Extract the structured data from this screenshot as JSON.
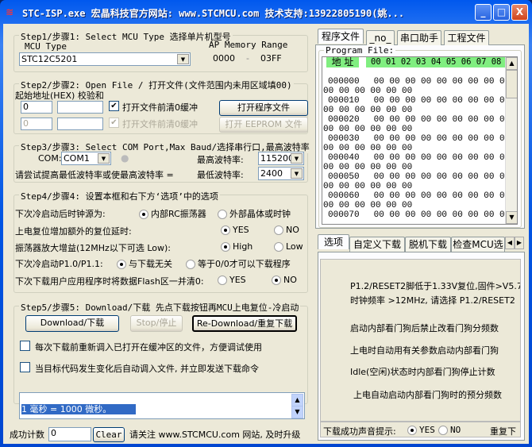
{
  "window": {
    "title": "STC-ISP.exe    宏晶科技官方网站: www.STCMCU.com  技术支持:13922805190(姚...",
    "controls": {
      "minimize": "_",
      "maximize": "□",
      "close": "X"
    }
  },
  "step1": {
    "legend": "Step1/步骤1: Select MCU Type  选择单片机型号",
    "mcu_type_label": "MCU Type",
    "mcu_type_value": "STC12C5201",
    "ap_memory_label": "AP Memory Range",
    "ap_start": "0000",
    "ap_dash": "-",
    "ap_end": "03FF"
  },
  "step2": {
    "legend": "Step2/步骤2: Open File / 打开文件(文件范围内未用区域填00)",
    "start_addr_label": "起始地址(HEX) 校验和",
    "addr1": "0",
    "checksum1": "",
    "clear_cb1_label": "打开文件前清0缓冲",
    "clear_cb1_checked": true,
    "open_program_btn": "打开程序文件",
    "addr2": "0",
    "checksum2": "",
    "clear_cb2_label": "打开文件前清0缓冲",
    "clear_cb2_checked": true,
    "open_eeprom_btn": "打开 EEPROM 文件"
  },
  "step3": {
    "legend": "Step3/步骤3: Select COM Port,Max Baud/选择串行口,最高波特率",
    "com_label": "COM:",
    "com_value": "COM1",
    "max_baud_label": "最高波特率:",
    "max_baud_value": "115200",
    "hint": "请尝试提高最低波特率或使最高波特率 =",
    "min_baud_label": "最低波特率:",
    "min_baud_value": "2400"
  },
  "step4": {
    "legend": "Step4/步骤4: 设置本框和右下方‘选项’中的选项",
    "rows": [
      {
        "label": "下次冷启动后时钟源为:",
        "opt1": "内部RC振荡器",
        "opt2": "外部晶体或时钟",
        "selected": 1
      },
      {
        "label": "上电复位增加额外的复位延时:",
        "opt1": "YES",
        "opt2": "NO",
        "selected": 1
      },
      {
        "label": "振荡器放大增益(12MHz以下可选 Low):",
        "opt1": "High",
        "opt2": "Low",
        "selected": 1
      },
      {
        "label": "下次冷启动P1.0/P1.1:",
        "opt1": "与下载无关",
        "opt2": "等于0/0才可以下载程序",
        "selected": 1
      },
      {
        "label": "下次下载用户应用程序时将数据Flash区一并清0:",
        "opt1": "YES",
        "opt2": "NO",
        "selected": 2
      }
    ]
  },
  "step5": {
    "legend": "Step5/步骤5: Download/下载  先点下载按钮再MCU上电复位-冷启动",
    "download_btn": "Download/下载",
    "stop_btn": "Stop/停止",
    "redownload_btn": "Re-Download/重复下载",
    "reload_cb_label": "每次下载前重新调入已打开在缓冲区的文件，方便调试使用",
    "reload_cb_checked": false,
    "auto_cb_label": "当目标代码发生变化后自动调入文件, 并立即发送下载命令",
    "auto_cb_checked": false,
    "log_text": "  1 毫秒 = 1000 微秒。"
  },
  "footer": {
    "success_count_label": "成功计数",
    "success_count": "0",
    "clear_btn": "Clear",
    "notice": "请关注 www.STCMCU.com 网站, 及时升级"
  },
  "right_tabs": [
    "程序文件",
    "_no_",
    "串口助手",
    "工程文件"
  ],
  "program_file": {
    "legend": "Program File:",
    "addr_header": "地 址",
    "col_header": "00 01 02 03 04 05 06 07 08 0",
    "rows": [
      {
        "addr": "000000",
        "bytes": "00 00 00 00 00 00 00 00 0",
        "cont": "00 00 00 00 00 00"
      },
      {
        "addr": "000010",
        "bytes": "00 00 00 00 00 00 00 00 0",
        "cont": "00 00 00 00 00 00"
      },
      {
        "addr": "000020",
        "bytes": "00 00 00 00 00 00 00 00 0",
        "cont": "00 00 00 00 00 00"
      },
      {
        "addr": "000030",
        "bytes": "00 00 00 00 00 00 00 00 0",
        "cont": "00 00 00 00 00 00"
      },
      {
        "addr": "000040",
        "bytes": "00 00 00 00 00 00 00 00 0",
        "cont": "00 00 00 00 00 00"
      },
      {
        "addr": "000050",
        "bytes": "00 00 00 00 00 00 00 00 0",
        "cont": "00 00 00 00 00 00"
      },
      {
        "addr": "000060",
        "bytes": "00 00 00 00 00 00 00 00 0",
        "cont": "00 00 00 00 00 00"
      },
      {
        "addr": "000070",
        "bytes": "00 00 00 00 00 00 00 00 0",
        "cont": ""
      }
    ]
  },
  "option_tabs": [
    "选项",
    "自定义下载",
    "脱机下载",
    "检查MCU选"
  ],
  "options": {
    "lines": [
      "P1.2/RESET2脚低于1.33V复位,固件>V5.7",
      "时钟频率 >12MHz, 请选择 P1.2/RESET2",
      "启动内部看门狗后禁止改看门狗分频数",
      "上电时自动用有关参数启动内部看门狗",
      "Idle(空闲)状态时内部看门狗停止计数",
      "上电自动启动内部看门狗时的预分频数"
    ],
    "sound_label": "下载成功声音提示:",
    "sound_yes": "YES",
    "sound_no": "NO",
    "sound_selected": "YES",
    "repeat_label": "重复下"
  },
  "colors": {
    "title_bar": "#0054e3",
    "hex_header": "#80ee80",
    "selection": "#316ac5",
    "face": "#ece9d8"
  }
}
